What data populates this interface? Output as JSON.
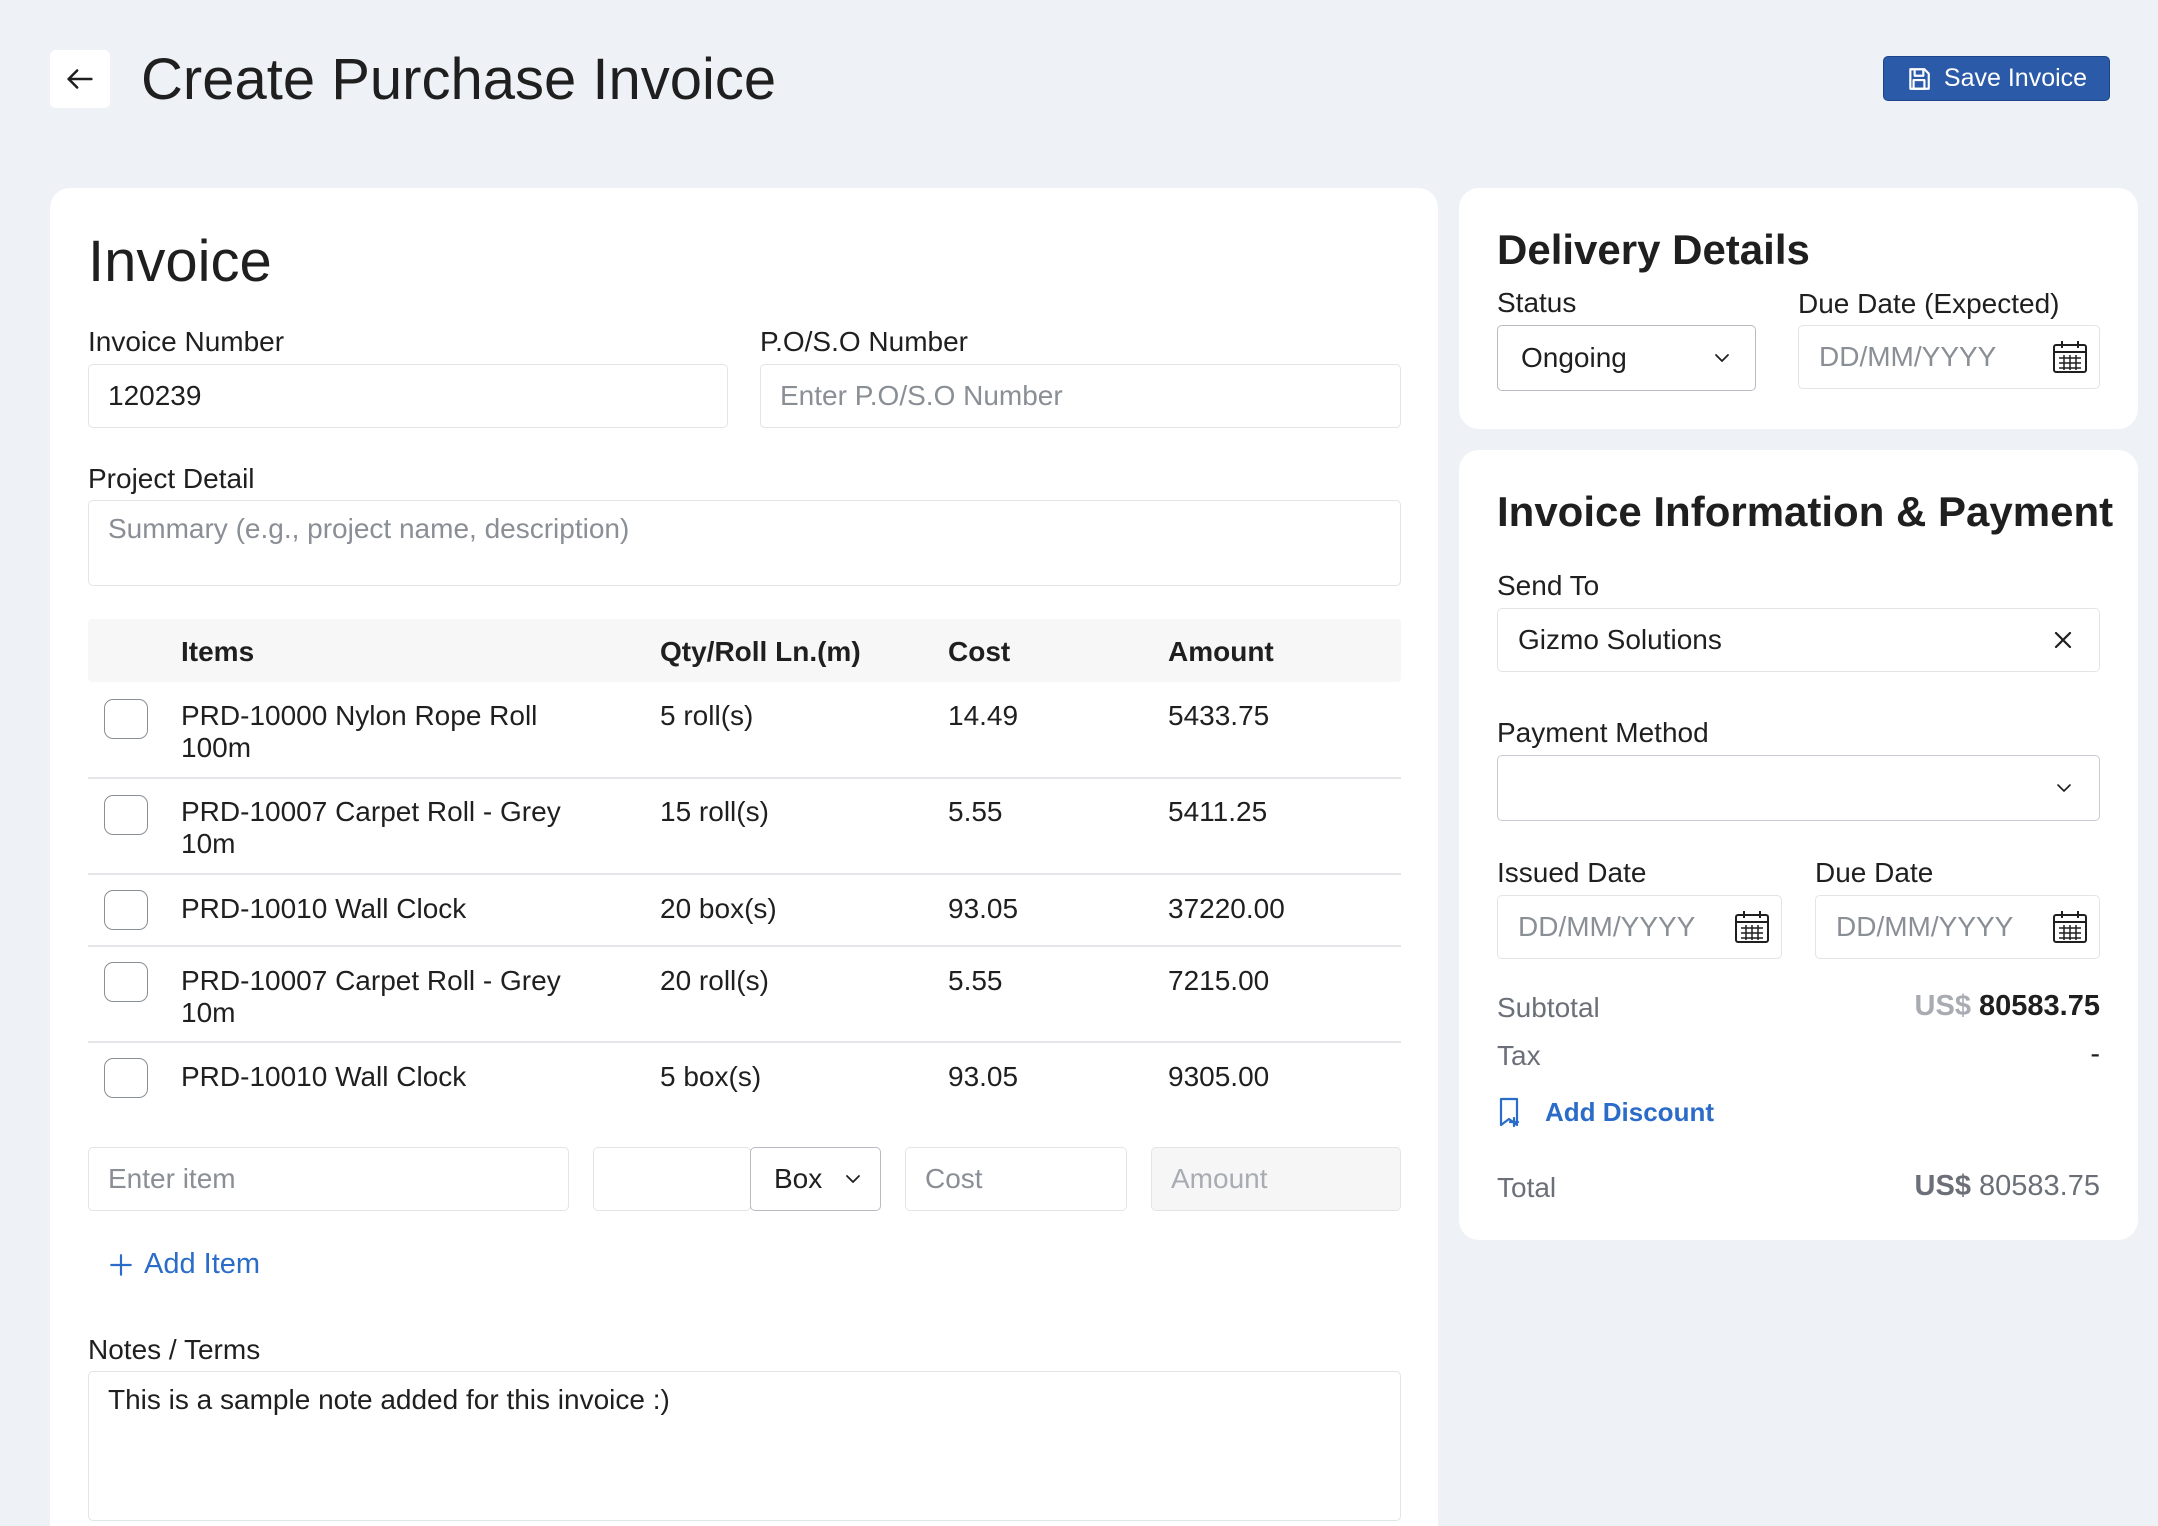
{
  "header": {
    "title": "Create Purchase Invoice",
    "save_label": "Save Invoice"
  },
  "invoice": {
    "heading": "Invoice",
    "invoice_number_label": "Invoice Number",
    "invoice_number_value": "120239",
    "po_label": "P.O/S.O Number",
    "po_placeholder": "Enter P.O/S.O Number",
    "project_label": "Project Detail",
    "project_placeholder": "Summary (e.g., project name, description)",
    "table": {
      "headers": [
        "Items",
        "Qty/Roll Ln.(m)",
        "Cost",
        "Amount"
      ],
      "rows": [
        {
          "item_line1": "PRD-10000 Nylon Rope Roll",
          "item_line2": "100m",
          "qty": "5 roll(s)",
          "cost": "14.49",
          "amount": "5433.75"
        },
        {
          "item_line1": "PRD-10007 Carpet Roll - Grey",
          "item_line2": "10m",
          "qty": "15 roll(s)",
          "cost": "5.55",
          "amount": "5411.25"
        },
        {
          "item_line1": "PRD-10010 Wall Clock",
          "item_line2": "",
          "qty": "20 box(s)",
          "cost": "93.05",
          "amount": "37220.00"
        },
        {
          "item_line1": "PRD-10007 Carpet Roll - Grey",
          "item_line2": "10m",
          "qty": "20 roll(s)",
          "cost": "5.55",
          "amount": "7215.00"
        },
        {
          "item_line1": "PRD-10010 Wall Clock",
          "item_line2": "",
          "qty": "5 box(s)",
          "cost": "93.05",
          "amount": "9305.00"
        }
      ]
    },
    "new_item": {
      "item_placeholder": "Enter item",
      "unit_value": "Box",
      "cost_placeholder": "Cost",
      "amount_placeholder": "Amount"
    },
    "add_item_label": "Add Item",
    "notes_label": "Notes / Terms",
    "notes_value": "This is a sample note added for this invoice :)"
  },
  "delivery": {
    "heading": "Delivery Details",
    "status_label": "Status",
    "status_value": "Ongoing",
    "due_label": "Due Date (Expected)",
    "due_placeholder": "DD/MM/YYYY"
  },
  "payment": {
    "heading": "Invoice Information & Payment",
    "send_to_label": "Send To",
    "send_to_value": "Gizmo Solutions",
    "method_label": "Payment Method",
    "method_value": "",
    "issued_label": "Issued Date",
    "issued_placeholder": "DD/MM/YYYY",
    "due_label": "Due Date",
    "due_placeholder": "DD/MM/YYYY",
    "subtotal_label": "Subtotal",
    "subtotal_currency": "US$",
    "subtotal_value": "80583.75",
    "tax_label": "Tax",
    "tax_value": "-",
    "add_discount_label": "Add Discount",
    "total_label": "Total",
    "total_currency": "US$",
    "total_value": "80583.75"
  }
}
